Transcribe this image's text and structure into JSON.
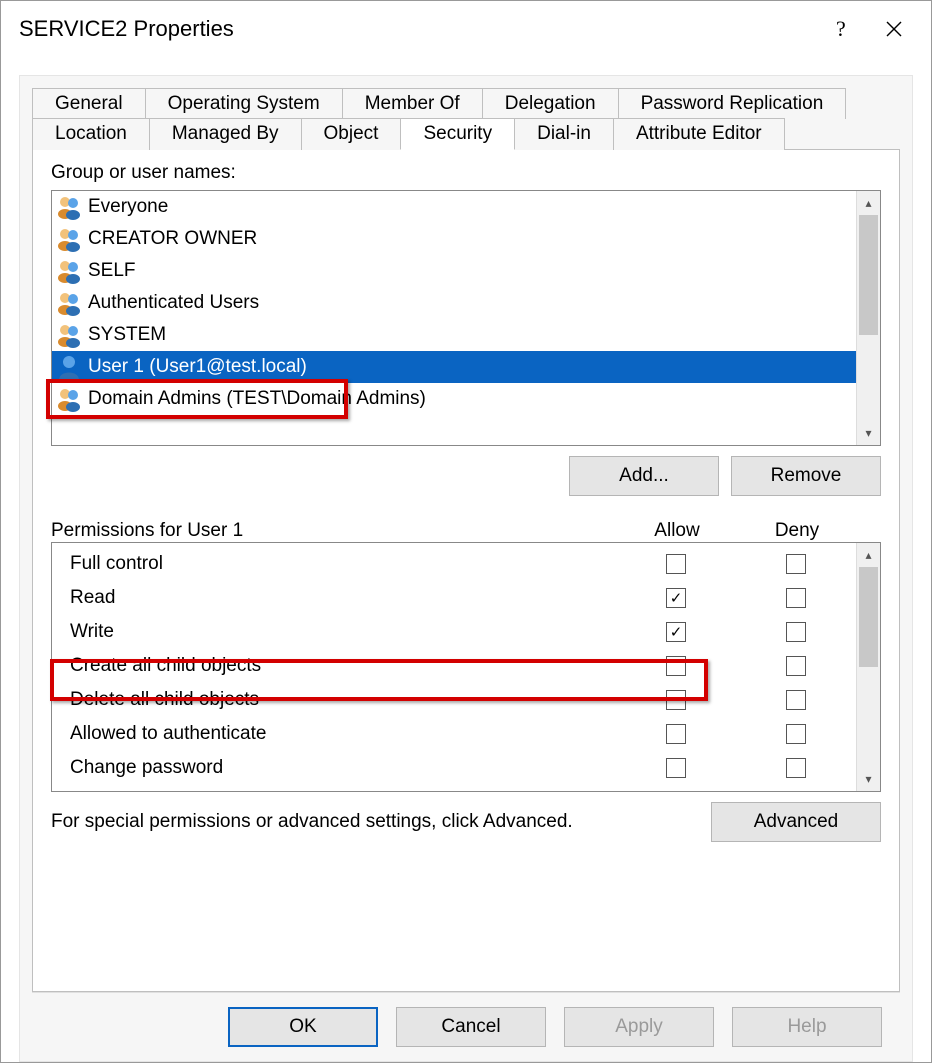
{
  "window": {
    "title": "SERVICE2 Properties"
  },
  "tabs": {
    "row1": [
      "General",
      "Operating System",
      "Member Of",
      "Delegation",
      "Password Replication"
    ],
    "row2": [
      "Location",
      "Managed By",
      "Object",
      "Security",
      "Dial-in",
      "Attribute Editor"
    ],
    "active": "Security"
  },
  "groups": {
    "label": "Group or user names:",
    "items": [
      {
        "type": "group",
        "name": "Everyone"
      },
      {
        "type": "group",
        "name": "CREATOR OWNER"
      },
      {
        "type": "group",
        "name": "SELF"
      },
      {
        "type": "group",
        "name": "Authenticated Users"
      },
      {
        "type": "group",
        "name": "SYSTEM"
      },
      {
        "type": "user",
        "name": "User 1 (User1@test.local)",
        "selected": true
      },
      {
        "type": "group",
        "name": "Domain Admins (TEST\\Domain Admins)"
      }
    ]
  },
  "buttons": {
    "add": "Add...",
    "remove": "Remove",
    "advanced": "Advanced",
    "ok": "OK",
    "cancel": "Cancel",
    "apply": "Apply",
    "help": "Help"
  },
  "permissions": {
    "label": "Permissions for User 1",
    "col_allow": "Allow",
    "col_deny": "Deny",
    "items": [
      {
        "name": "Full control",
        "allow": false,
        "deny": false
      },
      {
        "name": "Read",
        "allow": true,
        "deny": false
      },
      {
        "name": "Write",
        "allow": true,
        "deny": false,
        "highlight": true
      },
      {
        "name": "Create all child objects",
        "allow": false,
        "deny": false
      },
      {
        "name": "Delete all child objects",
        "allow": false,
        "deny": false
      },
      {
        "name": "Allowed to authenticate",
        "allow": false,
        "deny": false
      },
      {
        "name": "Change password",
        "allow": false,
        "deny": false
      }
    ]
  },
  "special_text": "For special permissions or advanced settings, click Advanced."
}
